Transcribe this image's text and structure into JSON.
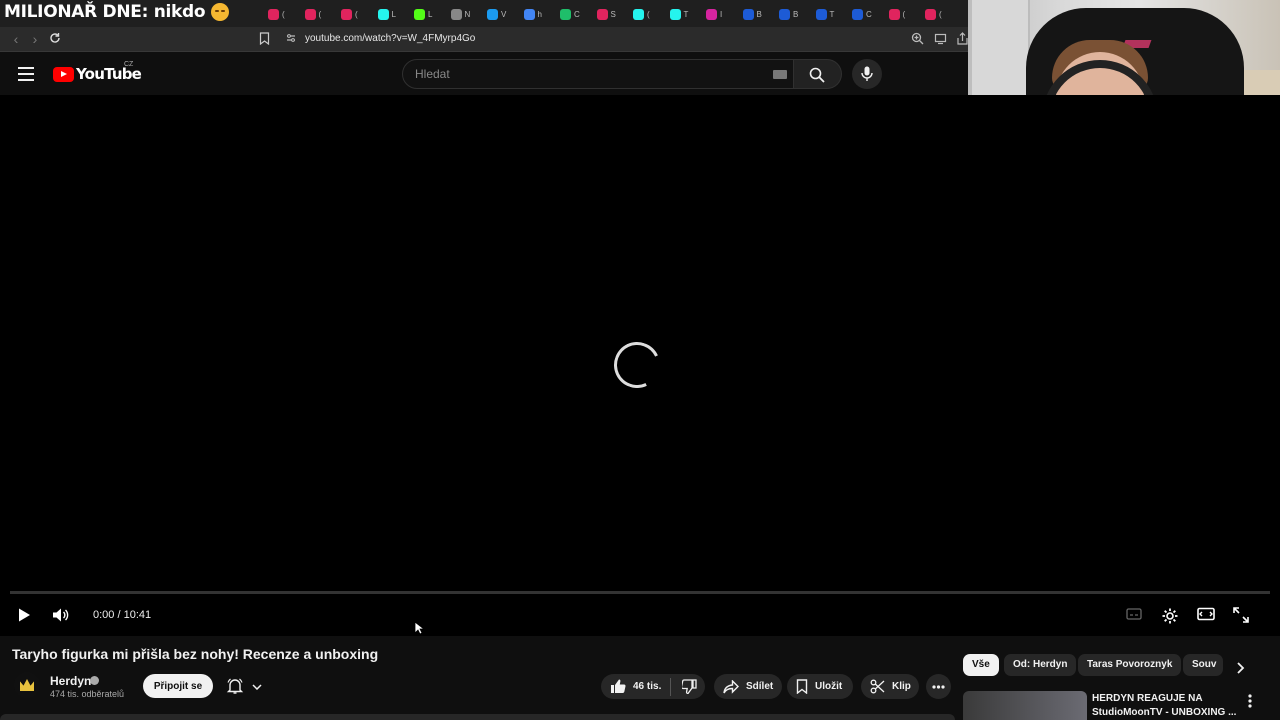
{
  "overlay": {
    "title": "MILIONAŘ DNE: nikdo"
  },
  "browser": {
    "tabs": [
      {
        "label": "(",
        "color": "#e0245e"
      },
      {
        "label": "(",
        "color": "#e0245e"
      },
      {
        "label": "(",
        "color": "#e0245e"
      },
      {
        "label": "L",
        "color": "#25f4ee"
      },
      {
        "label": "L",
        "color": "#53fc18"
      },
      {
        "label": "N",
        "color": "#888888"
      },
      {
        "label": "V",
        "color": "#1b9bf0"
      },
      {
        "label": "h",
        "color": "#4285f4"
      },
      {
        "label": "C",
        "color": "#1fbe6a"
      },
      {
        "label": "S",
        "color": "#e0245e"
      },
      {
        "label": "(",
        "color": "#25f4ee"
      },
      {
        "label": "T",
        "color": "#25f4ee"
      },
      {
        "label": "I",
        "color": "#d6249f"
      },
      {
        "label": "B",
        "color": "#1d5bd6"
      },
      {
        "label": "B",
        "color": "#1d5bd6"
      },
      {
        "label": "T",
        "color": "#1d5bd6"
      },
      {
        "label": "C",
        "color": "#1d5bd6"
      },
      {
        "label": "(",
        "color": "#e0245e"
      },
      {
        "label": "(",
        "color": "#e0245e"
      }
    ],
    "url": "youtube.com/watch?v=W_4FMyrp4Go"
  },
  "youtube": {
    "logo_text": "YouTube",
    "region": "CZ",
    "search_placeholder": "Hledat"
  },
  "player": {
    "time": "0:00 / 10:41",
    "progress": 0
  },
  "video": {
    "title": "Taryho figurka mi přišla bez nohy! Recenze a unboxing",
    "channel": "Herdyn",
    "subscribers": "474 tis. odběratelů",
    "subscribe_label": "Připojit se",
    "likes": "46 tis.",
    "share_label": "Sdílet",
    "save_label": "Uložit",
    "clip_label": "Klip"
  },
  "chips": [
    "Vše",
    "Od: Herdyn",
    "Taras Povoroznyk",
    "Souv"
  ],
  "recommendation": {
    "title": "HERDYN REAGUJE NA StudioMoonTV - UNBOXING ..."
  }
}
